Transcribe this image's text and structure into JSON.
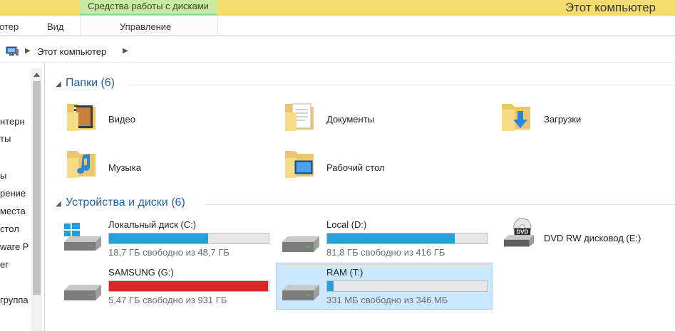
{
  "titlebar": {
    "context_tab": "Средства работы с дисками",
    "window_title": "Этот компьютер"
  },
  "ribbon": {
    "tab_computer": "отер",
    "tab_view": "Вид",
    "tab_manage": "Управление"
  },
  "address": {
    "icon": "computer-icon",
    "path": "Этот компьютер"
  },
  "nav": {
    "items": [
      "нтерн",
      "ты",
      "ы",
      "рение",
      "места",
      "стол",
      "ware P",
      "er",
      "группа"
    ]
  },
  "folders_group": {
    "title": "Папки (6)",
    "items": [
      {
        "label": "Видео",
        "icon": "video-folder-icon"
      },
      {
        "label": "Документы",
        "icon": "documents-folder-icon"
      },
      {
        "label": "Загрузки",
        "icon": "downloads-folder-icon"
      },
      {
        "label": "Музыка",
        "icon": "music-folder-icon"
      },
      {
        "label": "Рабочий стол",
        "icon": "desktop-folder-icon"
      }
    ]
  },
  "drives_group": {
    "title": "Устройства и диски (6)",
    "drives": [
      {
        "name": "Локальный диск (C:)",
        "free": "18,7 ГБ свободно из 48,7 ГБ",
        "used_fraction": 0.62,
        "bar_color": "#26a0da",
        "icon": "windows-drive-icon"
      },
      {
        "name": "Local (D:)",
        "free": "81,8 ГБ свободно из 416 ГБ",
        "used_fraction": 0.8,
        "bar_color": "#26a0da",
        "icon": "hard-drive-icon"
      },
      {
        "name": "DVD RW дисковод (E:)",
        "icon": "dvd-drive-icon",
        "dvd_label": "DVD"
      },
      {
        "name": "SAMSUNG (G:)",
        "free": "5,47 ГБ свободно из 931 ГБ",
        "used_fraction": 0.994,
        "bar_color": "#da2626",
        "icon": "hard-drive-icon"
      },
      {
        "name": "RAM (T:)",
        "free": "331 МБ свободно из 346 МБ",
        "used_fraction": 0.04,
        "bar_color": "#26a0da",
        "icon": "hard-drive-icon",
        "selected": true
      }
    ]
  }
}
